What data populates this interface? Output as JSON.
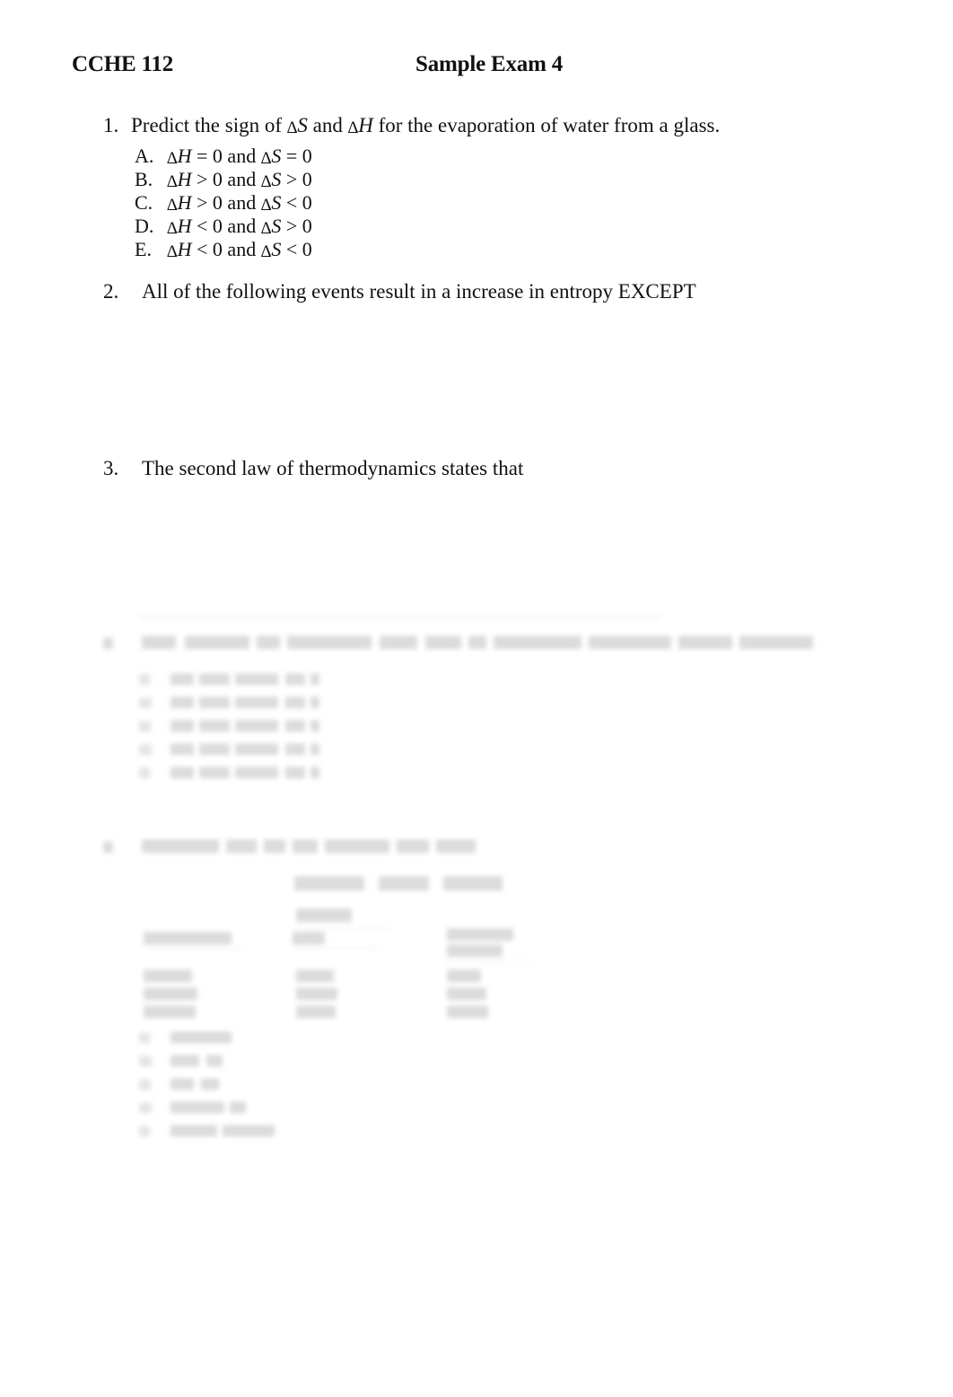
{
  "header": {
    "course": "CCHE 112",
    "title": "Sample Exam 4"
  },
  "questions": [
    {
      "number": "1.",
      "text_prefix": "Predict the sign of ",
      "sym1": "∆",
      "var1": "S",
      "text_mid": " and ",
      "sym2": "∆",
      "var2": "H",
      "text_suffix": " for the evaporation of water from a glass.",
      "full_text": "Predict the sign of ∆S and ∆H for the evaporation of water from a glass.",
      "options": [
        {
          "letter": "A.",
          "delta1": "∆",
          "v1": "H",
          "op1": " = 0 and ",
          "delta2": "∆",
          "v2": "S",
          "op2": " = 0",
          "full": "∆H = 0 and ∆S = 0"
        },
        {
          "letter": "B.",
          "delta1": "∆",
          "v1": "H",
          "op1": " > 0 and ",
          "delta2": "∆",
          "v2": "S",
          "op2": " > 0",
          "full": "∆H > 0 and ∆S > 0"
        },
        {
          "letter": "C.",
          "delta1": "∆",
          "v1": "H",
          "op1": " > 0 and ",
          "delta2": "∆",
          "v2": "S",
          "op2": " < 0",
          "full": "∆H > 0 and ∆S < 0"
        },
        {
          "letter": "D.",
          "delta1": "∆",
          "v1": "H",
          "op1": " < 0 and ",
          "delta2": "∆",
          "v2": "S",
          "op2": " > 0",
          "full": "∆H < 0 and ∆S > 0"
        },
        {
          "letter": "E.",
          "delta1": "∆",
          "v1": "H",
          "op1": " < 0 and ",
          "delta2": "∆",
          "v2": "S",
          "op2": " < 0",
          "full": "∆H < 0 and ∆S < 0"
        }
      ]
    },
    {
      "number": "2.",
      "full_text": "All of the following events result in a increase in entropy EXCEPT",
      "options": []
    },
    {
      "number": "3.",
      "full_text": "The second law of thermodynamics states that",
      "options": []
    }
  ],
  "faded_region": {
    "note": "lower portion of page is faded/washed-out in the scan and is illegible",
    "legible": false,
    "blocks": [
      {
        "kind": "rule",
        "label": "faint-horizontal-line"
      },
      {
        "kind": "question",
        "label": "question-4-stem",
        "option_count": 5
      },
      {
        "kind": "question",
        "label": "question-5-stem"
      },
      {
        "kind": "equation",
        "label": "reaction-equation",
        "term_count": 3
      },
      {
        "kind": "table",
        "label": "thermodynamic-data-table",
        "columns": 3,
        "rows": 3
      },
      {
        "kind": "options",
        "label": "question-5-options",
        "option_count": 5
      }
    ]
  }
}
